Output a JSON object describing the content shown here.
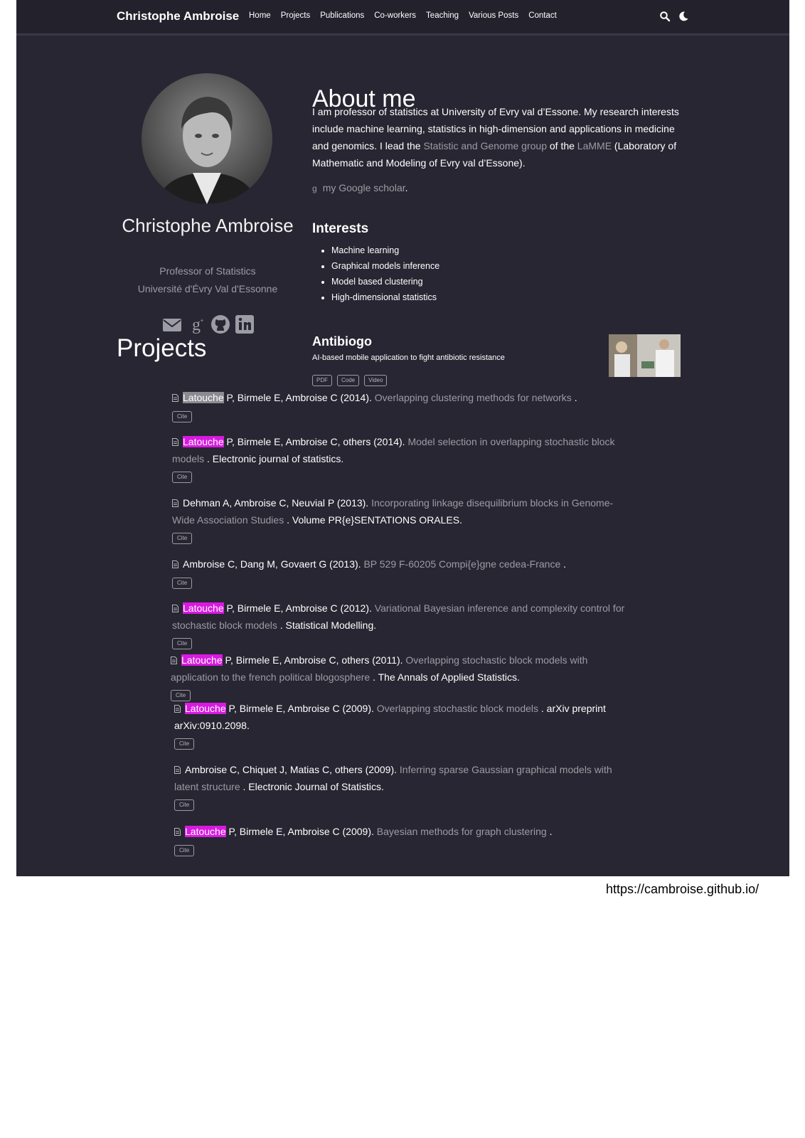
{
  "nav": {
    "brand": "Christophe Ambroise",
    "links": [
      "Home",
      "Projects",
      "Publications",
      "Co-workers",
      "Teaching",
      "Various Posts",
      "Contact"
    ]
  },
  "profile": {
    "name": "Christophe Ambroise",
    "role": "Professor of Statistics",
    "organization": "Université d'Évry Val d'Essonne",
    "social_icons": [
      "envelope-icon",
      "google-scholar-icon",
      "github-icon",
      "linkedin-icon"
    ]
  },
  "about": {
    "title": "About me",
    "text_1": "I am professor of statistics at University of Evry val d’Essone. My research interests include machine learning, statistics in high-dimension and applications in medicine and genomics. I lead the ",
    "link_group": "Statistic and Genome group",
    "text_2": " of the ",
    "link_lab": "LaMME",
    "text_3": " (Laboratory of Mathematic and Modeling of Evry val d’Essone).",
    "scholar_link": "my Google scholar",
    "scholar_period": "."
  },
  "interests": {
    "title": "Interests",
    "items": [
      "Machine learning",
      "Graphical models inference",
      "Model based clustering",
      "High-dimensional statistics"
    ]
  },
  "projects": {
    "title": "Projects",
    "project": {
      "name": "Antibiogo",
      "description": "AI-based mobile application to fight antibiotic resistance",
      "buttons": [
        "PDF",
        "Code",
        "Video"
      ]
    }
  },
  "publications": {
    "cite_label": "Cite",
    "items": [
      {
        "first": "Latouche",
        "authors": " P, Birmele E, Ambroise C (2014). ",
        "title": "Overlapping clustering methods for networks",
        "venue": " ."
      },
      {
        "first": "Latouche",
        "authors": " P, Birmele E, Ambroise C, others (2014). ",
        "title": "Model selection in overlapping stochastic block models",
        "venue": " . Electronic journal of statistics."
      },
      {
        "first": "",
        "authors": "Dehman A, Ambroise C, Neuvial P (2013). ",
        "title": "Incorporating linkage disequilibrium blocks in Genome-Wide Association Studies",
        "venue": " . Volume PR{e}SENTATIONS ORALES."
      },
      {
        "first": "",
        "authors": "Ambroise C, Dang M, Govaert G (2013). ",
        "title": "BP 529 F-60205 Compi{e}gne cedea-France",
        "venue": " ."
      },
      {
        "first": "Latouche",
        "authors": " P, Birmele E, Ambroise C (2012). ",
        "title": "Variational Bayesian inference and complexity control for stochastic block models",
        "venue": " . Statistical Modelling."
      },
      {
        "first": "Latouche",
        "authors": " P, Birmele E, Ambroise C, others (2011). ",
        "title": "Overlapping stochastic block models with application to the french political blogosphere",
        "venue": " . The Annals of Applied Statistics."
      },
      {
        "first": "Latouche",
        "authors": " P, Birmele E, Ambroise C (2009). ",
        "title": "Overlapping stochastic block models",
        "venue": " . arXiv preprint arXiv:0910.2098."
      },
      {
        "first": "",
        "authors": "Ambroise C, Chiquet J, Matias C, others (2009). ",
        "title": "Inferring sparse Gaussian graphical models with latent structure",
        "venue": " . Electronic Journal of Statistics."
      },
      {
        "first": "Latouche",
        "authors": " P, Birmele E, Ambroise C (2009). ",
        "title": "Bayesian methods for graph clustering",
        "venue": " ."
      }
    ]
  },
  "footer_url": "https://cambroise.github.io/",
  "colors": {
    "background": "#272632",
    "muted_text": "#9c9ca4",
    "highlight": "#d81ae0"
  }
}
